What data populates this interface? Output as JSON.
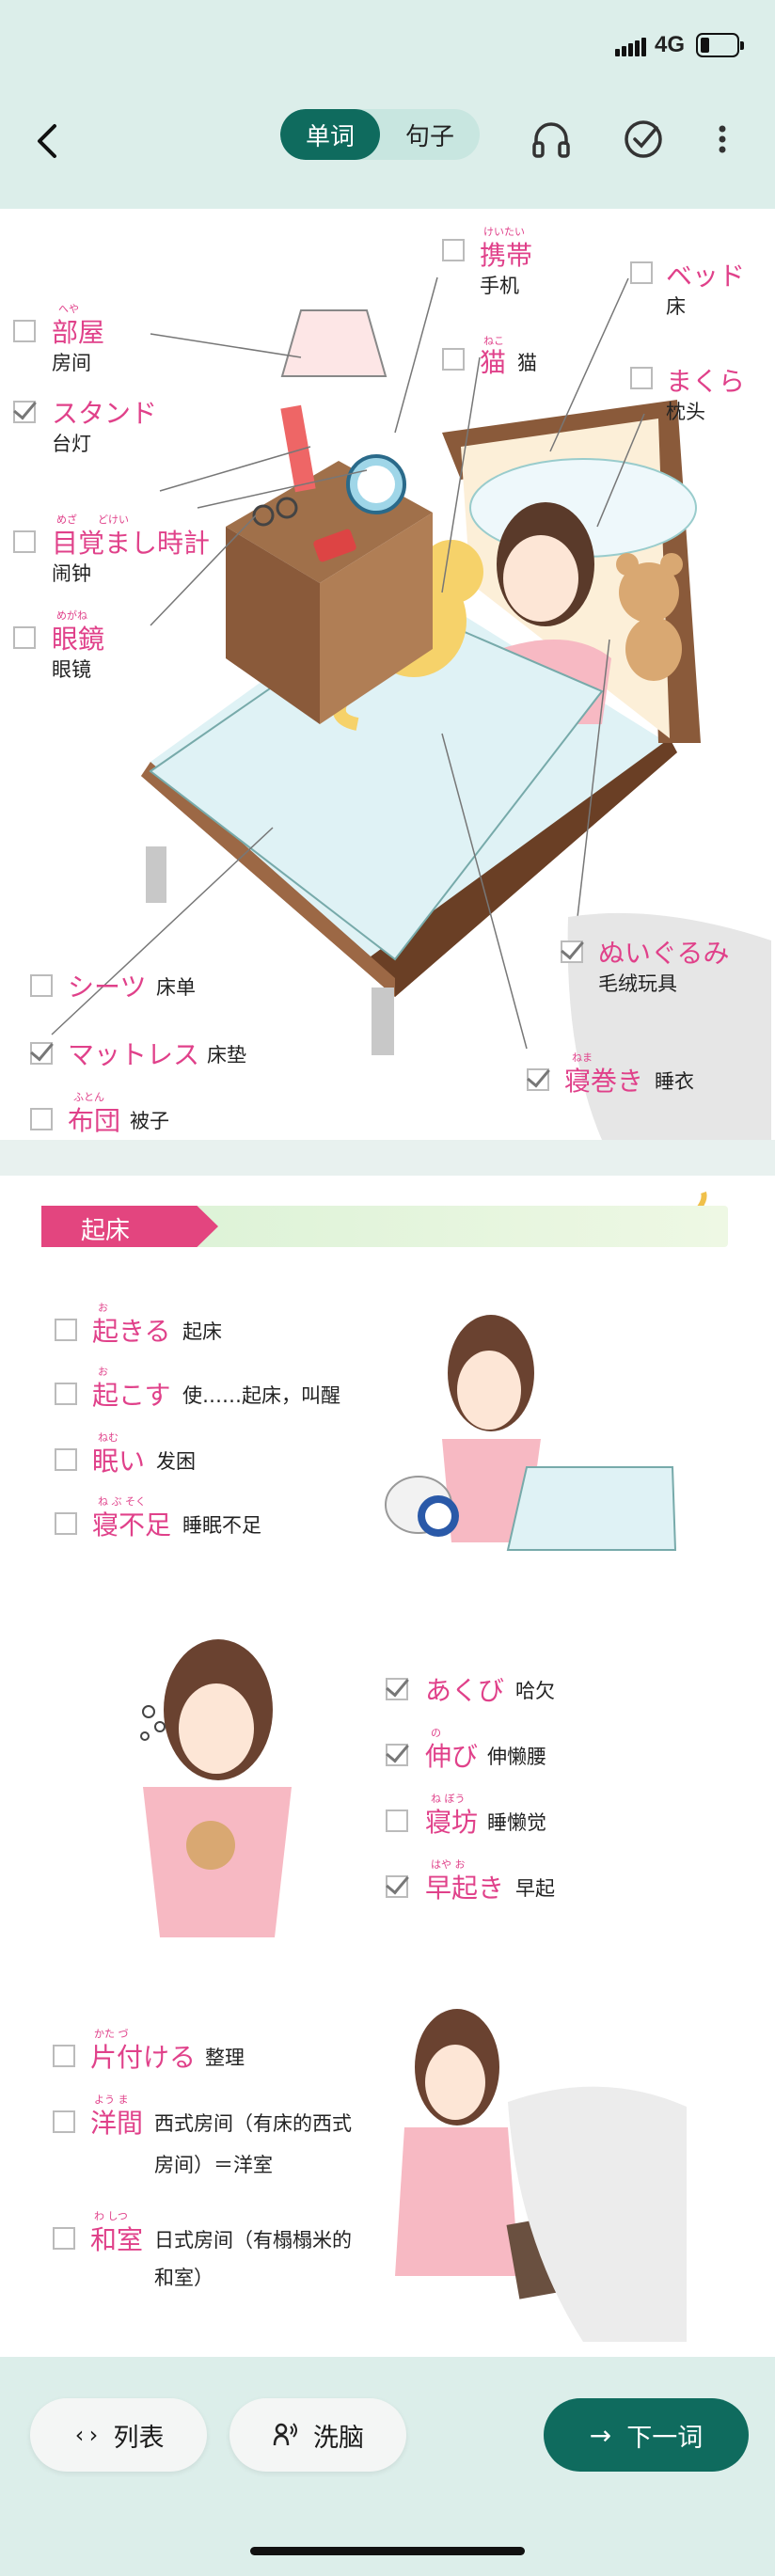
{
  "status_bar": {
    "network": "4G"
  },
  "nav": {
    "tabs": [
      {
        "label": "单词",
        "active": true
      },
      {
        "label": "句子",
        "active": false
      }
    ]
  },
  "bedroom": {
    "words": [
      {
        "furigana": "へや",
        "jp": "部屋",
        "cn": "房间",
        "checked": false
      },
      {
        "furigana": "",
        "jp": "スタンド",
        "cn": "台灯",
        "checked": true
      },
      {
        "furigana": "めざ　　どけい",
        "jp": "目覚まし時計",
        "cn": "闹钟",
        "checked": false
      },
      {
        "furigana": "めがね",
        "jp": "眼鏡",
        "cn": "眼镜",
        "checked": false
      },
      {
        "furigana": "けいたい",
        "jp": "携帯",
        "cn": "手机",
        "checked": false
      },
      {
        "furigana": "ねこ",
        "jp": "猫",
        "cn": "猫",
        "checked": false
      },
      {
        "furigana": "",
        "jp": "ベッド",
        "cn": "床",
        "checked": false
      },
      {
        "furigana": "",
        "jp": "まくら",
        "cn": "枕头",
        "checked": false
      },
      {
        "furigana": "",
        "jp": "シーツ",
        "cn": "床单",
        "checked": false
      },
      {
        "furigana": "",
        "jp": "マットレス",
        "cn": "床垫",
        "checked": true
      },
      {
        "furigana": "ふとん",
        "jp": "布団",
        "cn": "被子",
        "checked": false
      },
      {
        "furigana": "",
        "jp": "ぬいぐるみ",
        "cn": "毛绒玩具",
        "checked": true
      },
      {
        "furigana": "ねま",
        "jp": "寝巻き",
        "cn": "睡衣",
        "checked": true
      }
    ]
  },
  "getup": {
    "title": "起床",
    "words": [
      {
        "furigana": "お",
        "jp": "起きる",
        "cn": "起床",
        "checked": false
      },
      {
        "furigana": "お",
        "jp": "起こす",
        "cn": "使……起床，叫醒",
        "checked": false
      },
      {
        "furigana": "ねむ",
        "jp": "眠い",
        "cn": "发困",
        "checked": false
      },
      {
        "furigana": "ね ぶ そく",
        "jp": "寝不足",
        "cn": "睡眠不足",
        "checked": false
      },
      {
        "furigana": "",
        "jp": "あくび",
        "cn": "哈欠",
        "checked": true
      },
      {
        "furigana": "の",
        "jp": "伸び",
        "cn": "伸懒腰",
        "checked": true
      },
      {
        "furigana": "ね ぼう",
        "jp": "寝坊",
        "cn": "睡懒觉",
        "checked": false
      },
      {
        "furigana": "はや お",
        "jp": "早起き",
        "cn": "早起",
        "checked": true
      },
      {
        "furigana": "かた づ",
        "jp": "片付ける",
        "cn": "整理",
        "checked": false
      },
      {
        "furigana": "よう ま",
        "jp": "洋間",
        "cn": "西式房间（有床的西式",
        "cn2": "房间）＝洋室",
        "checked": false
      },
      {
        "furigana": "わ しつ",
        "jp": "和室",
        "cn": "日式房间（有榻榻米的",
        "cn2": "和室）",
        "checked": false
      }
    ]
  },
  "bottom": {
    "list_label": "列表",
    "brainwash_label": "洗脑",
    "next_label": "下一词"
  },
  "colors": {
    "accent": "#0f6b5e",
    "pink": "#e0418a",
    "mint": "#dceeea"
  }
}
